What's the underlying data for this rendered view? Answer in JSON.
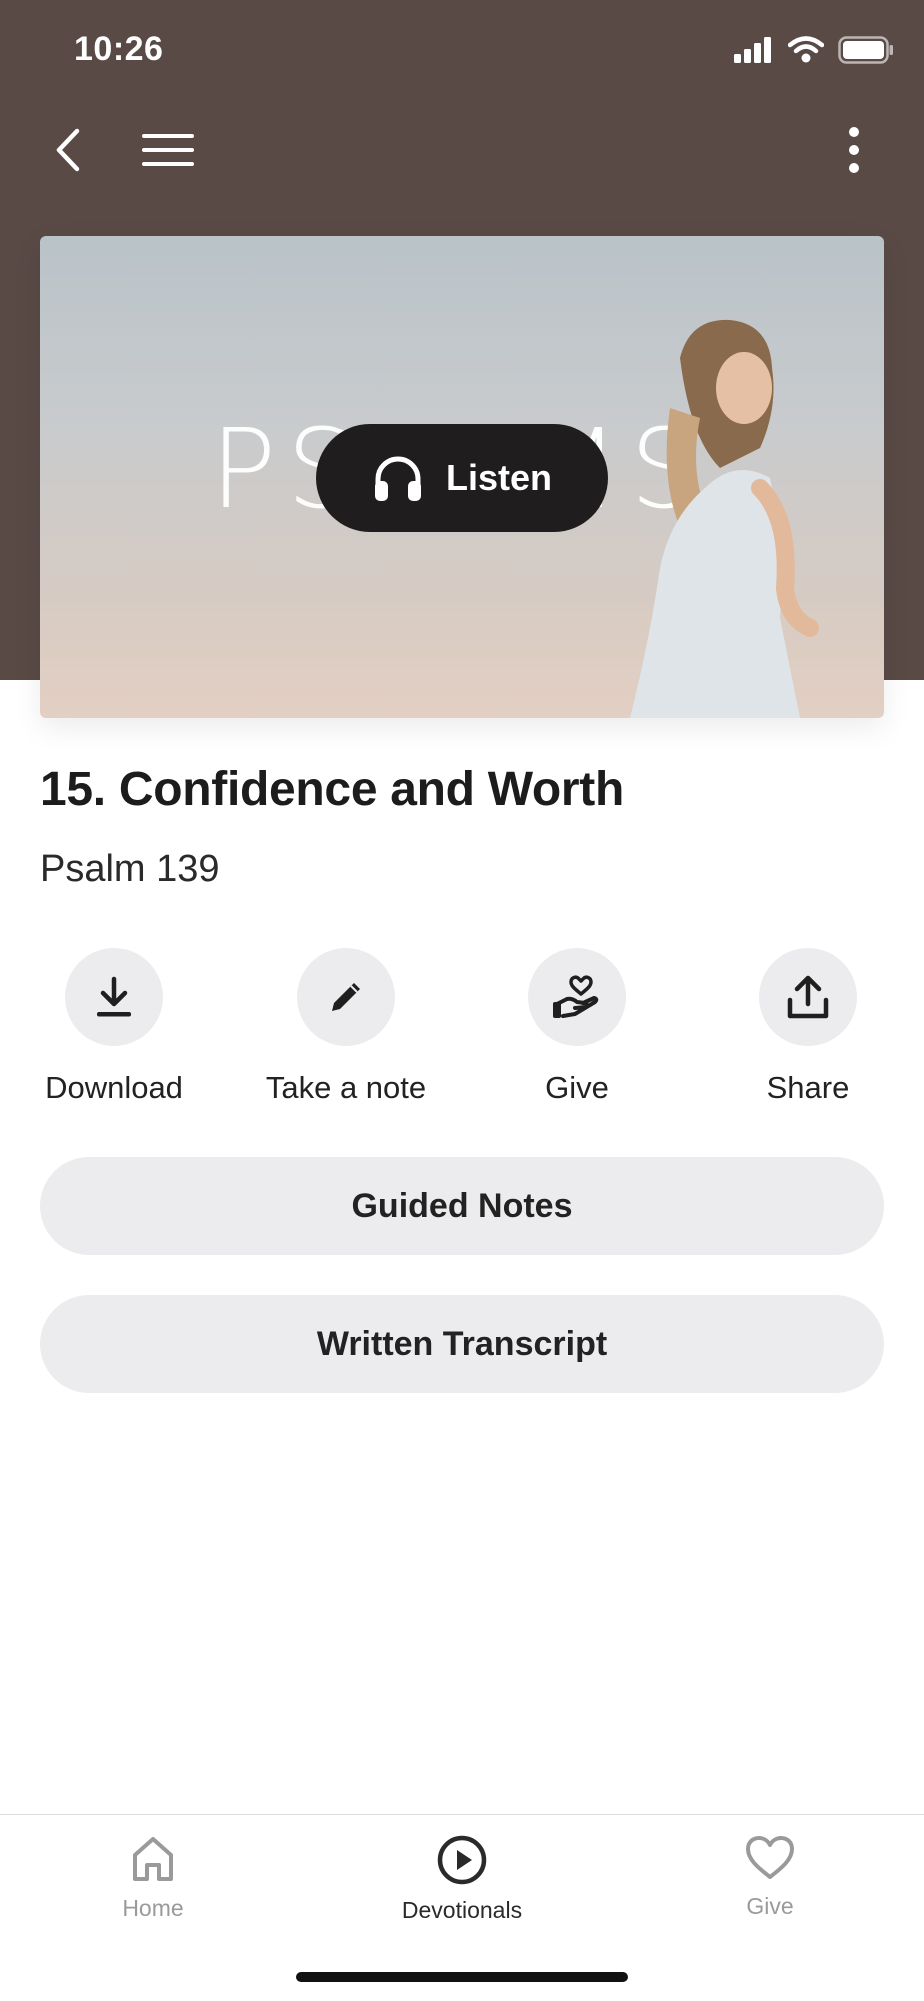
{
  "status_bar": {
    "time": "10:26"
  },
  "hero": {
    "series_word": "PSALMS",
    "listen_label": "Listen"
  },
  "episode": {
    "title": "15. Confidence and Worth",
    "passage": "Psalm 139"
  },
  "actions": [
    {
      "label": "Download",
      "icon": "download-icon"
    },
    {
      "label": "Take a note",
      "icon": "pencil-icon"
    },
    {
      "label": "Give",
      "icon": "heart-hand-icon"
    },
    {
      "label": "Share",
      "icon": "share-icon"
    }
  ],
  "buttons": {
    "guided_notes": "Guided Notes",
    "written_transcript": "Written Transcript"
  },
  "tabbar": {
    "tabs": [
      {
        "label": "Home",
        "icon": "home-icon",
        "active": false
      },
      {
        "label": "Devotionals",
        "icon": "play-circle-icon",
        "active": true
      },
      {
        "label": "Give",
        "icon": "heart-icon",
        "active": false
      }
    ]
  },
  "colors": {
    "header": "#594a46",
    "active_tab": "#2a2a2a",
    "inactive_tab": "#9a9a9a",
    "chip": "#ececee"
  }
}
